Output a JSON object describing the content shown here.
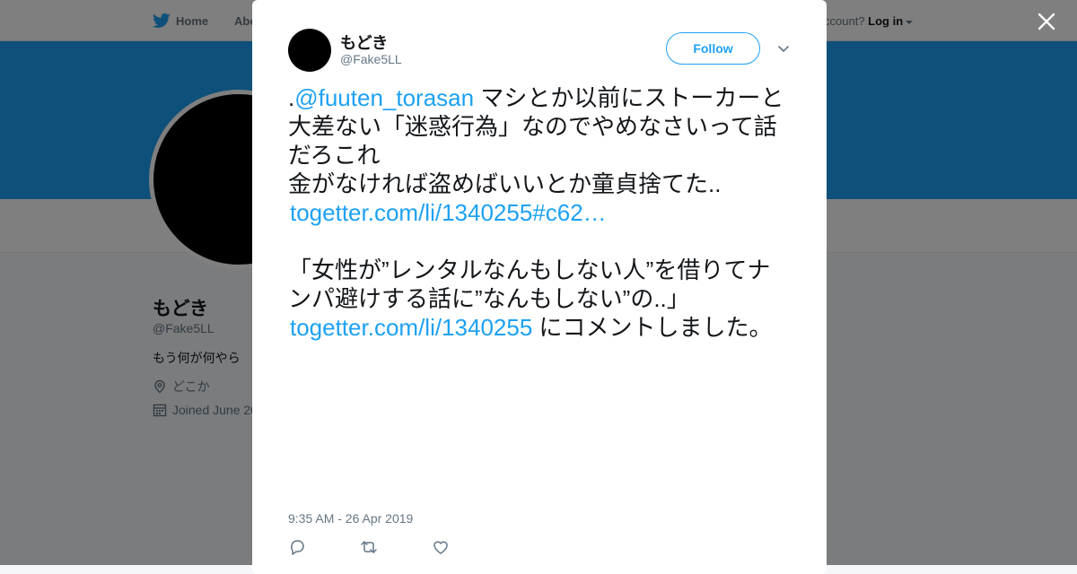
{
  "nav": {
    "home_label": "Home",
    "about_label": "Abo",
    "login_prompt": "ccount?",
    "login_label": "Log in"
  },
  "profile": {
    "name": "もどき",
    "handle": "@Fake5LL",
    "bio": "もう何が何やら",
    "location": "どこか",
    "joined": "Joined June 20"
  },
  "tweet": {
    "author_name": "もどき",
    "author_handle": "@Fake5LL",
    "follow_label": "Follow",
    "text_prefix": ".",
    "mention": "@fuuten_torasan",
    "text_part1": " マシとか以前にストーカーと大差ない「迷惑行為」なのでやめなさいって話だろこれ",
    "text_part2": "金がなければ盗めばいいとか童貞捨てた..",
    "link1": "togetter.com/li/1340255#c62…",
    "text_part3": "「女性が”レンタルなんもしない人”を借りてナンパ避けする話に”なんもしない”の..」",
    "link2": "togetter.com/li/1340255",
    "text_part4": " にコメントしました。",
    "timestamp": "9:35 AM - 26 Apr 2019"
  },
  "colors": {
    "accent": "#1da1f2",
    "banner": "#1da1f2",
    "text_primary": "#14171a",
    "text_secondary": "#657786"
  },
  "icons": {
    "brand": "twitter-bird-icon",
    "close": "close-icon",
    "more": "chevron-down-icon",
    "reply": "reply-icon",
    "retweet": "retweet-icon",
    "like": "heart-icon",
    "location": "location-pin-icon",
    "calendar": "calendar-icon"
  }
}
